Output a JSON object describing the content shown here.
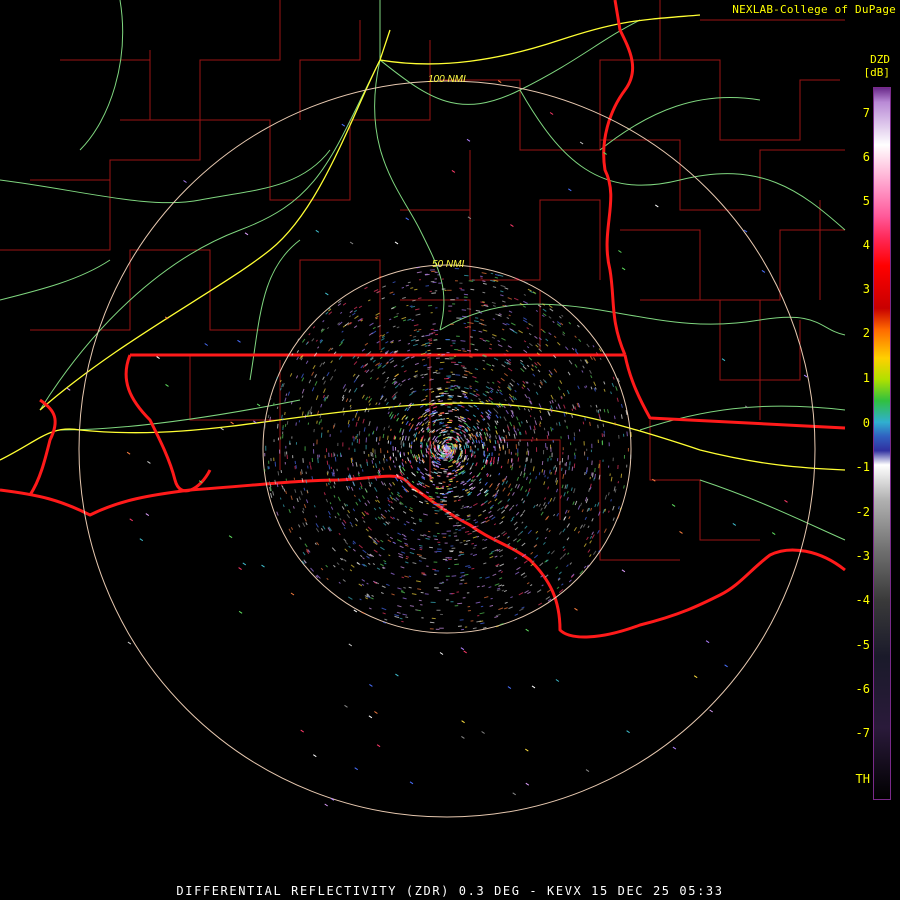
{
  "header": {
    "credit": "NEXLAB-College of DuPage",
    "product_code": "DZD",
    "unit": "[dB]"
  },
  "range_rings": [
    {
      "label": "100 NMI"
    },
    {
      "label": "50 NMI"
    }
  ],
  "legend": {
    "ticks": [
      "7",
      "6",
      "5",
      "4",
      "3",
      "2",
      "1",
      "0",
      "-1",
      "-2",
      "-3",
      "-4",
      "-5",
      "-6",
      "-7",
      "TH"
    ]
  },
  "footer": {
    "caption": "DIFFERENTIAL REFLECTIVITY (ZDR) 0.3 DEG - KEVX 15 DEC 25 05:33"
  },
  "colors": {
    "background": "#000000",
    "county_lines": "#9a1414",
    "state_lines": "#ff1a1a",
    "highways": "#7fd67f",
    "interstates": "#ffff33",
    "range_rings": "#e8c9b0",
    "text": "#ffff00"
  },
  "icons": [
    "radar-echo-icon"
  ]
}
